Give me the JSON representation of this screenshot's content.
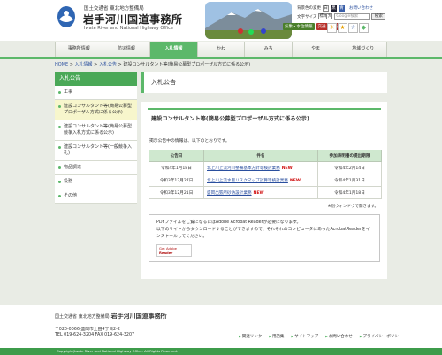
{
  "header": {
    "org_small": "国土交通省 東北地方整備局",
    "org_title": "岩手河川国道事務所",
    "org_en": "Iwate River and National Highway Office",
    "util": {
      "font_size_label": "文字サイズ",
      "font_normal": "標準",
      "font_large": "大",
      "font_small": "小",
      "contact": "お問い合わせ"
    },
    "util2": {
      "contrast_label": "背景色の変更",
      "search_placeholder": "Google検索",
      "search_button": "検索"
    },
    "weather": {
      "label1": "気象・",
      "label1b": "水位情報",
      "label2": "交通・",
      "label2b": "道路情報"
    }
  },
  "nav": {
    "items": [
      {
        "label": "事務所情報"
      },
      {
        "label": "防災情報"
      },
      {
        "label": "入札情報"
      },
      {
        "label": "かわ"
      },
      {
        "label": "みち"
      },
      {
        "label": "やま"
      },
      {
        "label": "地域づくり"
      }
    ]
  },
  "breadcrumb": {
    "home": "HOME",
    "sep": " > ",
    "l1": "入札情報",
    "l2": "入札公告",
    "current": "建設コンサルタント等(簡易公募型プロポーザル方式に係る公示)"
  },
  "sidebar": {
    "title": "入札公告",
    "items": [
      {
        "label": "工事"
      },
      {
        "label": "建設コンサルタント等(簡易公募型プロポーザル方式に係る公示)"
      },
      {
        "label": "建設コンサルタント等(簡易公募型競争入札方式に係る公示)"
      },
      {
        "label": "建設コンサルタント等(一般競争入札)"
      },
      {
        "label": "物品調達"
      },
      {
        "label": "役務"
      },
      {
        "label": "その他"
      }
    ]
  },
  "main": {
    "page_title": "入札公告",
    "section_title": "建設コンサルタント等(簡易公募型プロポーザル方式に係る公示)",
    "intro": "掲示公告中の情報は、以下のとおりです。",
    "table": {
      "headers": [
        "公告日",
        "件名",
        "参加表明書の提出期限"
      ],
      "rows": [
        {
          "date": "令和4年1月18日",
          "title": "北上川上流河川整備基本方針等検討業務",
          "new": "NEW",
          "deadline": "令和4年2月14日"
        },
        {
          "date": "令和3年12月27日",
          "title": "北上川上流水害リスクマップ計算等検討業務",
          "new": "NEW",
          "deadline": "令和4年1月31日"
        },
        {
          "date": "令和3年12月21日",
          "title": "盛岡出張所砂防設計業務",
          "new": "NEW",
          "deadline": "令和4年1月18日"
        }
      ]
    },
    "note": "※別ウィンドウで開きます。",
    "adobe": {
      "line1": "PDFファイルをご覧になるにはAdobe Acrobat Readerが必要になります。",
      "line2": "以下のサイトからダウンロードすることができますので、それぞれのコンピュータにあったAcrobatReaderをインストールしてください。",
      "badge1": "Get Adobe",
      "badge2": "Reader"
    }
  },
  "footer": {
    "org_small": "国土交通省 東北地方整備局",
    "org_title": "岩手河川国道事務所",
    "postal": "〒020-0066 盛岡市上田4丁目2-2",
    "phone": "TEL 019-624-3204 FAX 019-624-3207",
    "links": [
      {
        "label": "関連リンク"
      },
      {
        "label": "用語集"
      },
      {
        "label": "サイトマップ"
      },
      {
        "label": "お問い合わせ"
      },
      {
        "label": "プライバシーポリシー"
      }
    ],
    "copyright": "Copyright(Iwate River and National Highway Office. All Rights Reserved."
  },
  "colors": {
    "accent": "#5cb86a",
    "new": "#d01010",
    "link": "#2a4f9e"
  }
}
